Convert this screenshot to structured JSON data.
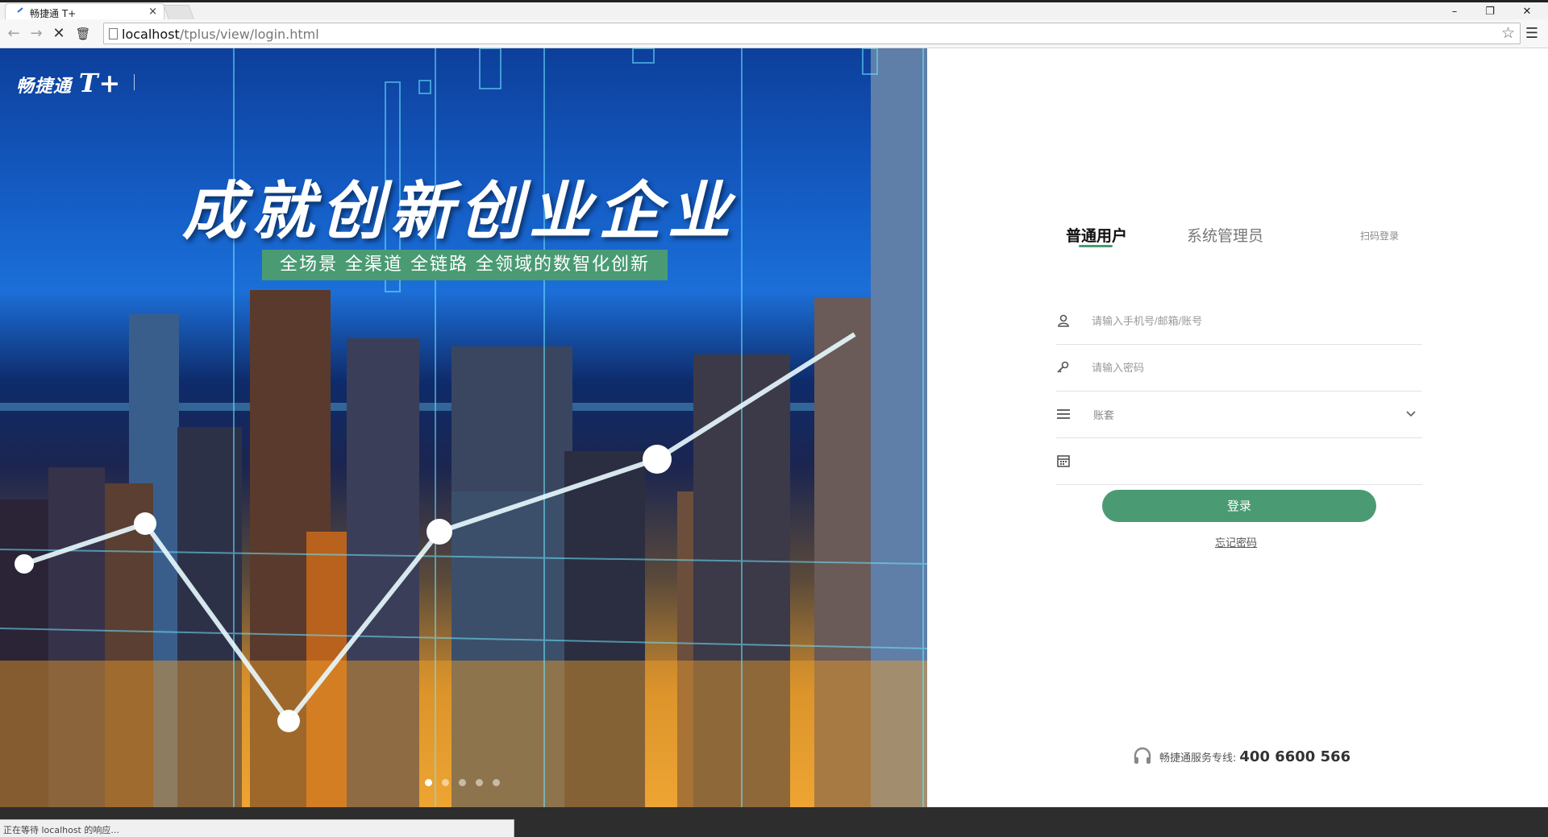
{
  "browser": {
    "tab_title": "畅捷通 T+",
    "tab_close": "×",
    "url_host": "localhost",
    "url_path": "/tplus/view/login.html",
    "window_controls": {
      "minimize": "–",
      "restore": "❐",
      "close": "✕"
    },
    "status_text": "正在等待 localhost 的响应..."
  },
  "banner": {
    "logo_text": "畅捷通",
    "logo_product": "T+",
    "headline": "成就创新创业企业",
    "subline": "全场景 全渠道 全链路 全领域的数智化创新",
    "slide_count": 5,
    "active_slide": 1
  },
  "login": {
    "tabs": [
      {
        "label": "普通用户",
        "active": true
      },
      {
        "label": "系统管理员",
        "active": false
      }
    ],
    "qr_login": "扫码登录",
    "account_placeholder": "请输入手机号/邮箱/账号",
    "password_placeholder": "请输入密码",
    "company_select": "账套",
    "date_value": "",
    "submit_label": "登录",
    "forgot_label": "忘记密码",
    "hotline_label": "畅捷通服务专线:",
    "hotline_number": "400 6600 566"
  },
  "colors": {
    "accent": "#4a9b73",
    "panel_bg": "#ffffff"
  },
  "icons": [
    "user-icon",
    "key-icon",
    "list-icon",
    "calendar-icon",
    "chevron-down-icon",
    "headset-icon",
    "star-icon",
    "reload-icon",
    "back-icon",
    "forward-icon"
  ]
}
